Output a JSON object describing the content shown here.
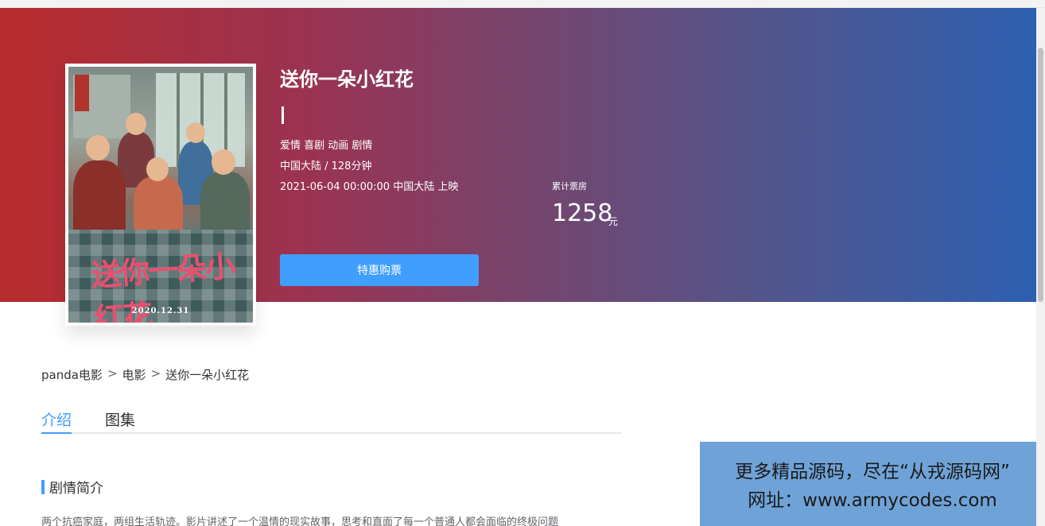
{
  "movie": {
    "title": "送你一朵小红花",
    "cursor_text": "|",
    "genres": "爱情 喜剧 动画 剧情",
    "region_duration": "中国大陆 / 128分钟",
    "release": "2021-06-04 00:00:00 中国大陆 上映",
    "box_office": {
      "label": "累计票房",
      "value": "1258",
      "unit": "元"
    },
    "buy_button": "特惠购票",
    "poster": {
      "title_art": "送你一朵小红花",
      "date": "2020.12.31"
    }
  },
  "breadcrumb": {
    "items": [
      "panda电影",
      "电影",
      "送你一朵小红花"
    ],
    "separator": ">"
  },
  "tabs": [
    {
      "label": "介绍",
      "active": true
    },
    {
      "label": "图集",
      "active": false
    }
  ],
  "section": {
    "title": "剧情简介",
    "summary": "两个抗癌家庭，两组生活轨迹。影片讲述了一个温情的现实故事，思考和直面了每一个普通人都会面临的终极问题"
  },
  "ad": {
    "line1": "更多精品源码，尽在“从戎源码网”",
    "line2": "网址：www.armycodes.com"
  },
  "colors": {
    "banner_start": "#b82c2c",
    "banner_end": "#2d5fb0",
    "accent": "#409eff",
    "ad_background": "#6fa3d8"
  }
}
